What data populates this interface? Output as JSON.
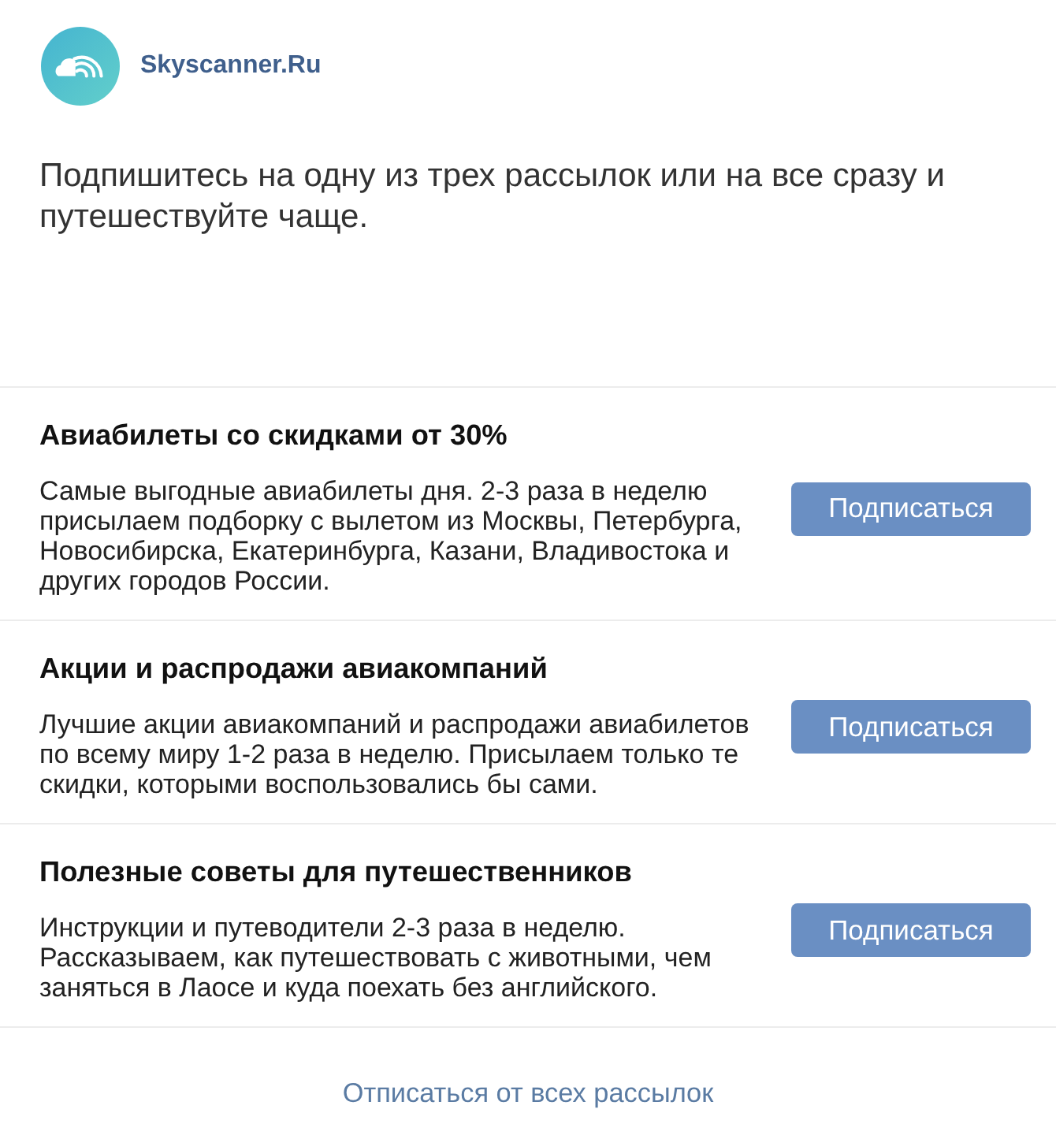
{
  "header": {
    "brand": "Skyscanner.Ru"
  },
  "intro": "Подпишитесь на одну из трех рассылок или на все сразу и путешествуйте чаще.",
  "subscriptions": [
    {
      "title": "Авиабилеты со скидками от 30%",
      "description": "Самые выгодные авиабилеты дня. 2-3 раза в неделю присылаем подборку с вылетом из Москвы, Петербурга, Новосибирска, Екатеринбурга, Казани, Владивостока и других городов России.",
      "button": "Подписаться"
    },
    {
      "title": "Акции и распродажи авиакомпаний",
      "description": "Лучшие акции авиакомпаний и распродажи авиабилетов по всему миру 1-2 раза в неделю. Присылаем только те скидки, которыми воспользовались бы сами.",
      "button": "Подписаться"
    },
    {
      "title": "Полезные советы для путешественников",
      "description": "Инструкции и путеводители 2-3 раза в неделю. Рассказываем, как путешествовать с животными, чем заняться в Лаосе и куда поехать без английского.",
      "button": "Подписаться"
    }
  ],
  "footer_link": "Отписаться от всех рассылок"
}
